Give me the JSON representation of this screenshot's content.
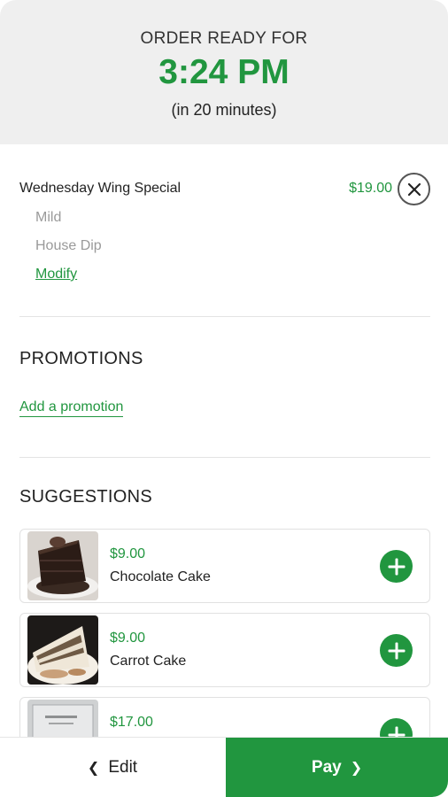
{
  "header": {
    "label": "ORDER READY FOR",
    "time": "3:24 PM",
    "subtitle": "(in 20 minutes)"
  },
  "order_item": {
    "name": "Wednesday Wing Special",
    "price": "$19.00",
    "remove_icon": "close-icon",
    "modifiers": [
      "Mild",
      "House Dip"
    ],
    "modify_label": "Modify"
  },
  "promotions": {
    "title": "PROMOTIONS",
    "add_label": "Add a promotion"
  },
  "suggestions": {
    "title": "SUGGESTIONS",
    "items": [
      {
        "price": "$9.00",
        "name": "Chocolate Cake",
        "icon": "plus-icon"
      },
      {
        "price": "$9.00",
        "name": "Carrot Cake",
        "icon": "plus-icon"
      },
      {
        "price": "$17.00",
        "name": "",
        "icon": "plus-icon"
      }
    ]
  },
  "footer": {
    "edit_label": "Edit",
    "pay_label": "Pay"
  },
  "colors": {
    "accent": "#21963f",
    "header_bg": "#efefef"
  }
}
